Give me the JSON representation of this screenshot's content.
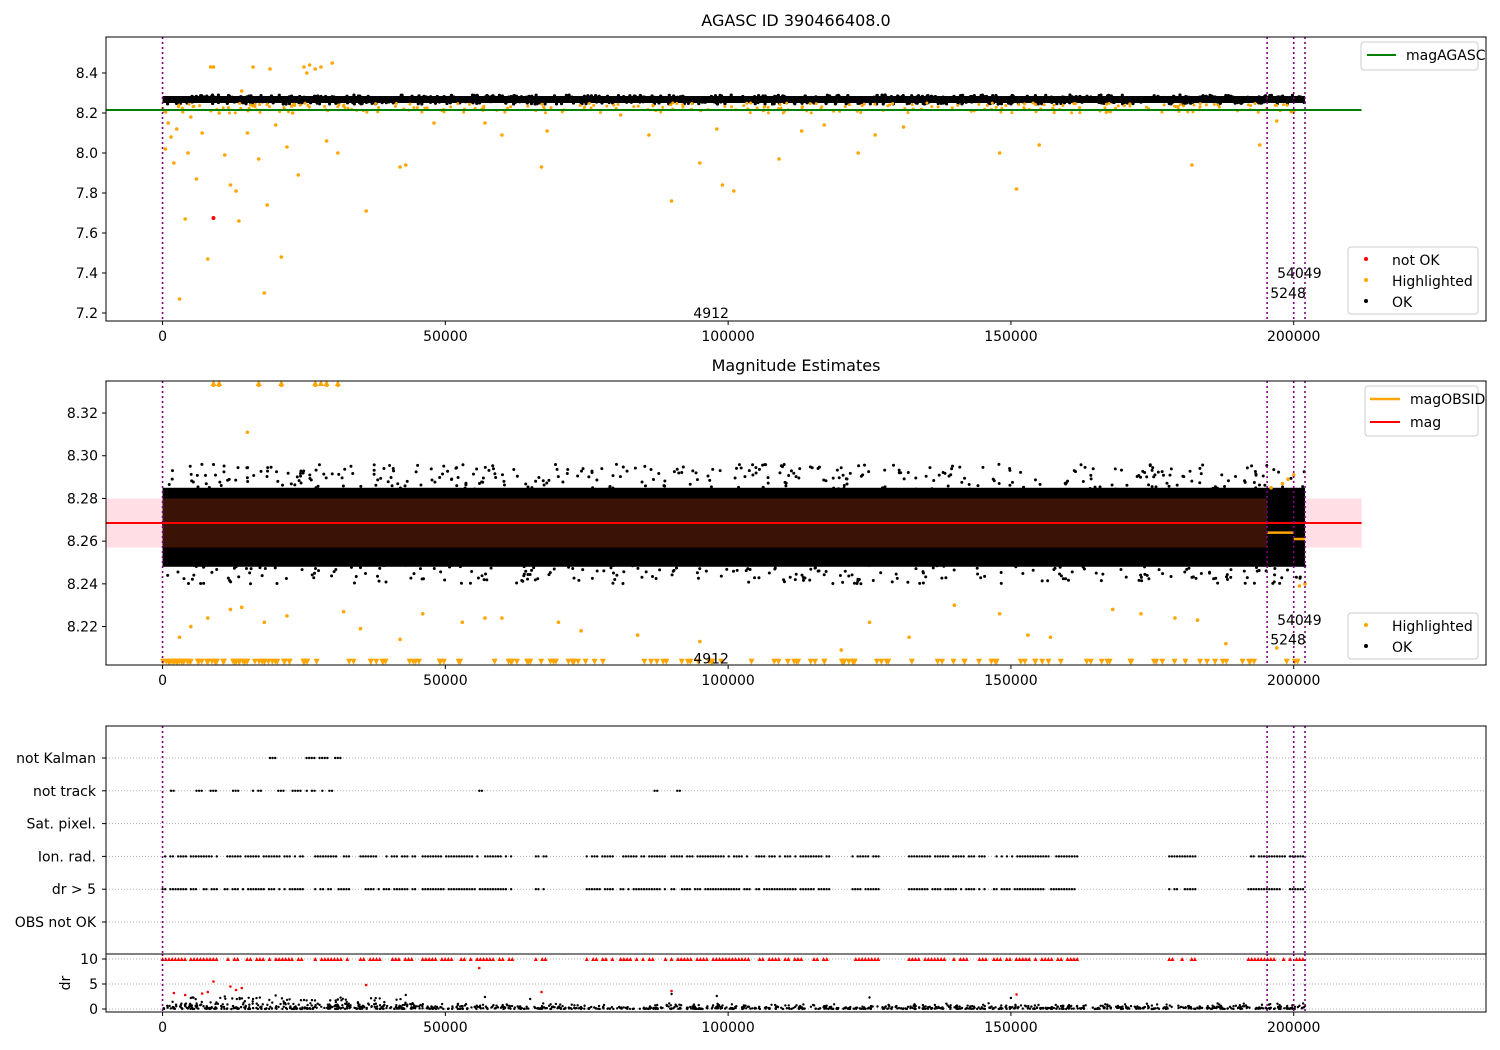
{
  "chart_data": [
    {
      "type": "scatter",
      "title": "AGASC ID 390466408.0",
      "xlim": [
        -10000,
        234000
      ],
      "ylim": [
        7.16,
        8.58
      ],
      "xticks": [
        0,
        50000,
        100000,
        150000,
        200000
      ],
      "yticks": [
        7.2,
        7.4,
        7.6,
        7.8,
        8.0,
        8.2,
        8.4
      ],
      "xtick_labels": [
        "0",
        "50000",
        "100000",
        "150000",
        "200000"
      ],
      "ytick_labels": [
        "7.2",
        "7.4",
        "7.6",
        "7.8",
        "8.0",
        "8.2",
        "8.4"
      ],
      "reference_line": {
        "name": "magAGASC",
        "y": 8.215,
        "x_range": [
          -10000,
          212000
        ],
        "color": "#008000"
      },
      "ok_band": {
        "x_start": 0,
        "x_end": 202000,
        "y_min": 8.245,
        "y_max": 8.29,
        "color": "#000000"
      },
      "highlighted_points": [
        [
          500,
          8.02
        ],
        [
          1000,
          8.15
        ],
        [
          1500,
          8.08
        ],
        [
          2000,
          7.95
        ],
        [
          2500,
          8.12
        ],
        [
          3000,
          7.27
        ],
        [
          3500,
          8.22
        ],
        [
          4000,
          7.67
        ],
        [
          4500,
          8.0
        ],
        [
          5000,
          8.18
        ],
        [
          6000,
          7.87
        ],
        [
          7000,
          8.1
        ],
        [
          8000,
          7.47
        ],
        [
          8500,
          8.43
        ],
        [
          9000,
          8.43
        ],
        [
          10000,
          8.2
        ],
        [
          11000,
          7.99
        ],
        [
          12000,
          7.84
        ],
        [
          13000,
          7.81
        ],
        [
          13500,
          7.66
        ],
        [
          14000,
          8.31
        ],
        [
          15000,
          8.1
        ],
        [
          16000,
          8.43
        ],
        [
          17000,
          7.97
        ],
        [
          18000,
          7.3
        ],
        [
          18500,
          7.74
        ],
        [
          19000,
          8.42
        ],
        [
          20000,
          8.14
        ],
        [
          21000,
          7.48
        ],
        [
          22000,
          8.03
        ],
        [
          23000,
          8.2
        ],
        [
          24000,
          7.89
        ],
        [
          25000,
          8.43
        ],
        [
          25500,
          8.4
        ],
        [
          26000,
          8.44
        ],
        [
          27000,
          8.42
        ],
        [
          28000,
          8.43
        ],
        [
          29000,
          8.06
        ],
        [
          30000,
          8.45
        ],
        [
          31000,
          8.0
        ],
        [
          36000,
          7.71
        ],
        [
          42000,
          7.93
        ],
        [
          43000,
          7.94
        ],
        [
          48000,
          8.15
        ],
        [
          57000,
          8.15
        ],
        [
          60000,
          8.09
        ],
        [
          67000,
          7.93
        ],
        [
          68000,
          8.11
        ],
        [
          81000,
          8.19
        ],
        [
          86000,
          8.09
        ],
        [
          90000,
          7.76
        ],
        [
          95000,
          7.95
        ],
        [
          98000,
          8.12
        ],
        [
          99000,
          7.84
        ],
        [
          101000,
          7.81
        ],
        [
          109000,
          7.97
        ],
        [
          113000,
          8.11
        ],
        [
          117000,
          8.14
        ],
        [
          123000,
          8.0
        ],
        [
          126000,
          8.09
        ],
        [
          131000,
          8.13
        ],
        [
          148000,
          8.0
        ],
        [
          151000,
          7.82
        ],
        [
          155000,
          8.04
        ],
        [
          182000,
          7.94
        ],
        [
          194000,
          8.04
        ],
        [
          197000,
          8.16
        ],
        [
          200000,
          8.21
        ]
      ],
      "not_ok_points": [
        [
          9000,
          7.675
        ]
      ],
      "legend": [
        "magAGASC",
        "not OK",
        "Highlighted",
        "OK"
      ],
      "annotations": [
        {
          "text": "4912",
          "x": 97000,
          "y": 7.2
        },
        {
          "text": "5248",
          "x": 199000,
          "y": 7.3
        },
        {
          "text": "54049",
          "x": 201000,
          "y": 7.4
        }
      ],
      "vlines": [
        0,
        195300,
        200000,
        202000
      ]
    },
    {
      "type": "scatter",
      "title": "Magnitude Estimates",
      "xlim": [
        -10000,
        234000
      ],
      "ylim": [
        8.202,
        8.335
      ],
      "xticks": [
        0,
        50000,
        100000,
        150000,
        200000
      ],
      "yticks": [
        8.22,
        8.24,
        8.26,
        8.28,
        8.3,
        8.32
      ],
      "xtick_labels": [
        "0",
        "50000",
        "100000",
        "150000",
        "200000"
      ],
      "ytick_labels": [
        "8.22",
        "8.24",
        "8.26",
        "8.28",
        "8.30",
        "8.32"
      ],
      "mag": {
        "name": "mag",
        "y": 8.2685,
        "band": [
          8.257,
          8.28
        ],
        "x_range": [
          -10000,
          212000
        ],
        "color": "#ff0000"
      },
      "mag_obsid": [
        {
          "x_start": 195300,
          "x_end": 200000,
          "y": 8.264
        },
        {
          "x_start": 200000,
          "x_end": 202000,
          "y": 8.261
        }
      ],
      "ok_band": {
        "x_start": 0,
        "x_end": 202000,
        "y_min": 8.24,
        "y_max": 8.296
      },
      "highlighted_points": [
        [
          3000,
          8.215
        ],
        [
          5000,
          8.22
        ],
        [
          8000,
          8.224
        ],
        [
          9000,
          8.333
        ],
        [
          10000,
          8.333
        ],
        [
          12000,
          8.228
        ],
        [
          14000,
          8.229
        ],
        [
          15000,
          8.311
        ],
        [
          17000,
          8.333
        ],
        [
          18000,
          8.222
        ],
        [
          21000,
          8.333
        ],
        [
          22000,
          8.225
        ],
        [
          27000,
          8.333
        ],
        [
          29000,
          8.333
        ],
        [
          31000,
          8.333
        ],
        [
          32000,
          8.227
        ],
        [
          35000,
          8.219
        ],
        [
          42000,
          8.214
        ],
        [
          46000,
          8.226
        ],
        [
          53000,
          8.222
        ],
        [
          57000,
          8.224
        ],
        [
          60000,
          8.224
        ],
        [
          70000,
          8.222
        ],
        [
          74000,
          8.218
        ],
        [
          84000,
          8.216
        ],
        [
          95000,
          8.213
        ],
        [
          120000,
          8.209
        ],
        [
          125000,
          8.222
        ],
        [
          132000,
          8.215
        ],
        [
          140000,
          8.23
        ],
        [
          148000,
          8.226
        ],
        [
          153000,
          8.216
        ],
        [
          157000,
          8.215
        ],
        [
          168000,
          8.228
        ],
        [
          173000,
          8.226
        ],
        [
          179000,
          8.224
        ],
        [
          183000,
          8.223
        ],
        [
          188000,
          8.212
        ],
        [
          196000,
          8.285
        ],
        [
          197000,
          8.21
        ],
        [
          198000,
          8.287
        ],
        [
          199000,
          8.289
        ],
        [
          200000,
          8.291
        ],
        [
          201000,
          8.239
        ],
        [
          202000,
          8.24
        ]
      ],
      "highlighted_low_markers_y": 8.2035,
      "legend": [
        "magOBSID",
        "mag",
        "Highlighted",
        "OK"
      ],
      "annotations": [
        {
          "text": "4912",
          "x": 97000,
          "y": 8.205
        },
        {
          "text": "5248",
          "x": 199000,
          "y": 8.214
        },
        {
          "text": "54049",
          "x": 201000,
          "y": 8.223
        }
      ],
      "vlines": [
        0,
        195300,
        200000,
        202000
      ]
    },
    {
      "type": "scatter",
      "title": "",
      "xlim": [
        -10000,
        234000
      ],
      "xticks": [
        0,
        50000,
        100000,
        150000,
        200000
      ],
      "xtick_labels": [
        "0",
        "50000",
        "100000",
        "150000",
        "200000"
      ],
      "flag_rows": [
        "not Kalman",
        "not track",
        "Sat. pixel.",
        "Ion. rad.",
        "dr > 5",
        "OBS not OK"
      ],
      "flag_segments": {
        "not Kalman": [
          [
            19000,
            20000
          ],
          [
            25000,
            32000
          ]
        ],
        "not track": [
          [
            0,
            1000
          ],
          [
            1500,
            2000
          ],
          [
            6000,
            7500
          ],
          [
            8500,
            10000
          ],
          [
            12000,
            13500
          ],
          [
            16000,
            17500
          ],
          [
            20000,
            21500
          ],
          [
            23000,
            24500
          ],
          [
            25500,
            28500
          ],
          [
            29500,
            30000
          ],
          [
            56000,
            56500
          ],
          [
            87000,
            87500
          ],
          [
            91000,
            91500
          ]
        ],
        "Sat. pixel.": [],
        "Ion. rad.": [
          [
            0,
            4500
          ],
          [
            5000,
            10000
          ],
          [
            11000,
            25000
          ],
          [
            27000,
            33000
          ],
          [
            35000,
            45000
          ],
          [
            46000,
            62000
          ],
          [
            66000,
            68000
          ],
          [
            75000,
            80000
          ],
          [
            81000,
            89000
          ],
          [
            90000,
            104000
          ],
          [
            105000,
            118000
          ],
          [
            122000,
            127000
          ],
          [
            132000,
            146000
          ],
          [
            147000,
            162000
          ],
          [
            178000,
            183000
          ],
          [
            192000,
            202000
          ]
        ],
        "dr > 5": [
          [
            0,
            4500
          ],
          [
            5000,
            10000
          ],
          [
            11000,
            25000
          ],
          [
            27000,
            33000
          ],
          [
            35000,
            45000
          ],
          [
            46000,
            62000
          ],
          [
            66000,
            68000
          ],
          [
            75000,
            80000
          ],
          [
            81000,
            89000
          ],
          [
            90000,
            104000
          ],
          [
            105000,
            118000
          ],
          [
            122000,
            127000
          ],
          [
            132000,
            146000
          ],
          [
            147000,
            162000
          ],
          [
            178000,
            183000
          ],
          [
            192000,
            202000
          ]
        ],
        "OBS not OK": []
      },
      "dr": {
        "ylabel": "dr",
        "ylim": [
          -0.6,
          11
        ],
        "yticks": [
          0,
          5,
          10
        ],
        "ytick_labels": [
          "0",
          "5",
          "10"
        ],
        "capped_value": 10,
        "outliers_red": [
          [
            2000,
            3.2
          ],
          [
            4000,
            2.8
          ],
          [
            7000,
            3.1
          ],
          [
            8000,
            3.4
          ],
          [
            9000,
            5.5
          ],
          [
            12000,
            4.5
          ],
          [
            13000,
            3.8
          ],
          [
            14000,
            4.2
          ],
          [
            36000,
            4.8
          ],
          [
            56000,
            8.2
          ],
          [
            67000,
            3.4
          ],
          [
            90000,
            3.6
          ],
          [
            151000,
            2.9
          ]
        ],
        "outliers_black": [
          [
            5000,
            2.2
          ],
          [
            11000,
            2.5
          ],
          [
            16000,
            2.0
          ],
          [
            20000,
            2.7
          ],
          [
            25000,
            1.8
          ],
          [
            43000,
            2.8
          ],
          [
            57000,
            2.4
          ],
          [
            65000,
            2.0
          ],
          [
            90000,
            3.0
          ],
          [
            98000,
            2.6
          ],
          [
            125000,
            2.3
          ],
          [
            150000,
            2.2
          ]
        ]
      },
      "vlines": [
        0,
        195300,
        200000,
        202000
      ]
    }
  ]
}
